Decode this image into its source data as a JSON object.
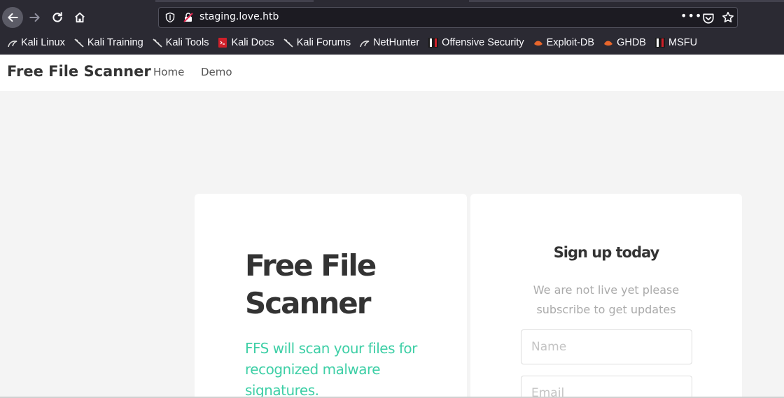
{
  "browser": {
    "url": "staging.love.htb",
    "menu_glyph": "•••"
  },
  "bookmarks": [
    {
      "label": "Kali Linux",
      "icon": "kali-dragon-icon"
    },
    {
      "label": "Kali Training",
      "icon": "kali-dragon-icon"
    },
    {
      "label": "Kali Tools",
      "icon": "kali-dragon-icon"
    },
    {
      "label": "Kali Docs",
      "icon": "kali-docs-icon"
    },
    {
      "label": "Kali Forums",
      "icon": "kali-dragon-icon"
    },
    {
      "label": "NetHunter",
      "icon": "kali-dragon-icon"
    },
    {
      "label": "Offensive Security",
      "icon": "offsec-icon"
    },
    {
      "label": "Exploit-DB",
      "icon": "exploitdb-icon"
    },
    {
      "label": "GHDB",
      "icon": "exploitdb-icon"
    },
    {
      "label": "MSFU",
      "icon": "offsec-icon"
    }
  ],
  "site_nav": {
    "brand": "Free File Scanner",
    "links": [
      "Home",
      "Demo"
    ]
  },
  "hero": {
    "title": "Free File Scanner",
    "subtitle": "FFS will scan your files for recognized malware signatures."
  },
  "signup": {
    "title": "Sign up today",
    "description": "We are not live yet please subscribe to get updates",
    "name_placeholder": "Name",
    "email_placeholder": "Email"
  },
  "colors": {
    "accent": "#3ecfa6",
    "chrome_bg": "#2b2a33",
    "page_bg": "#f4f4f4"
  }
}
